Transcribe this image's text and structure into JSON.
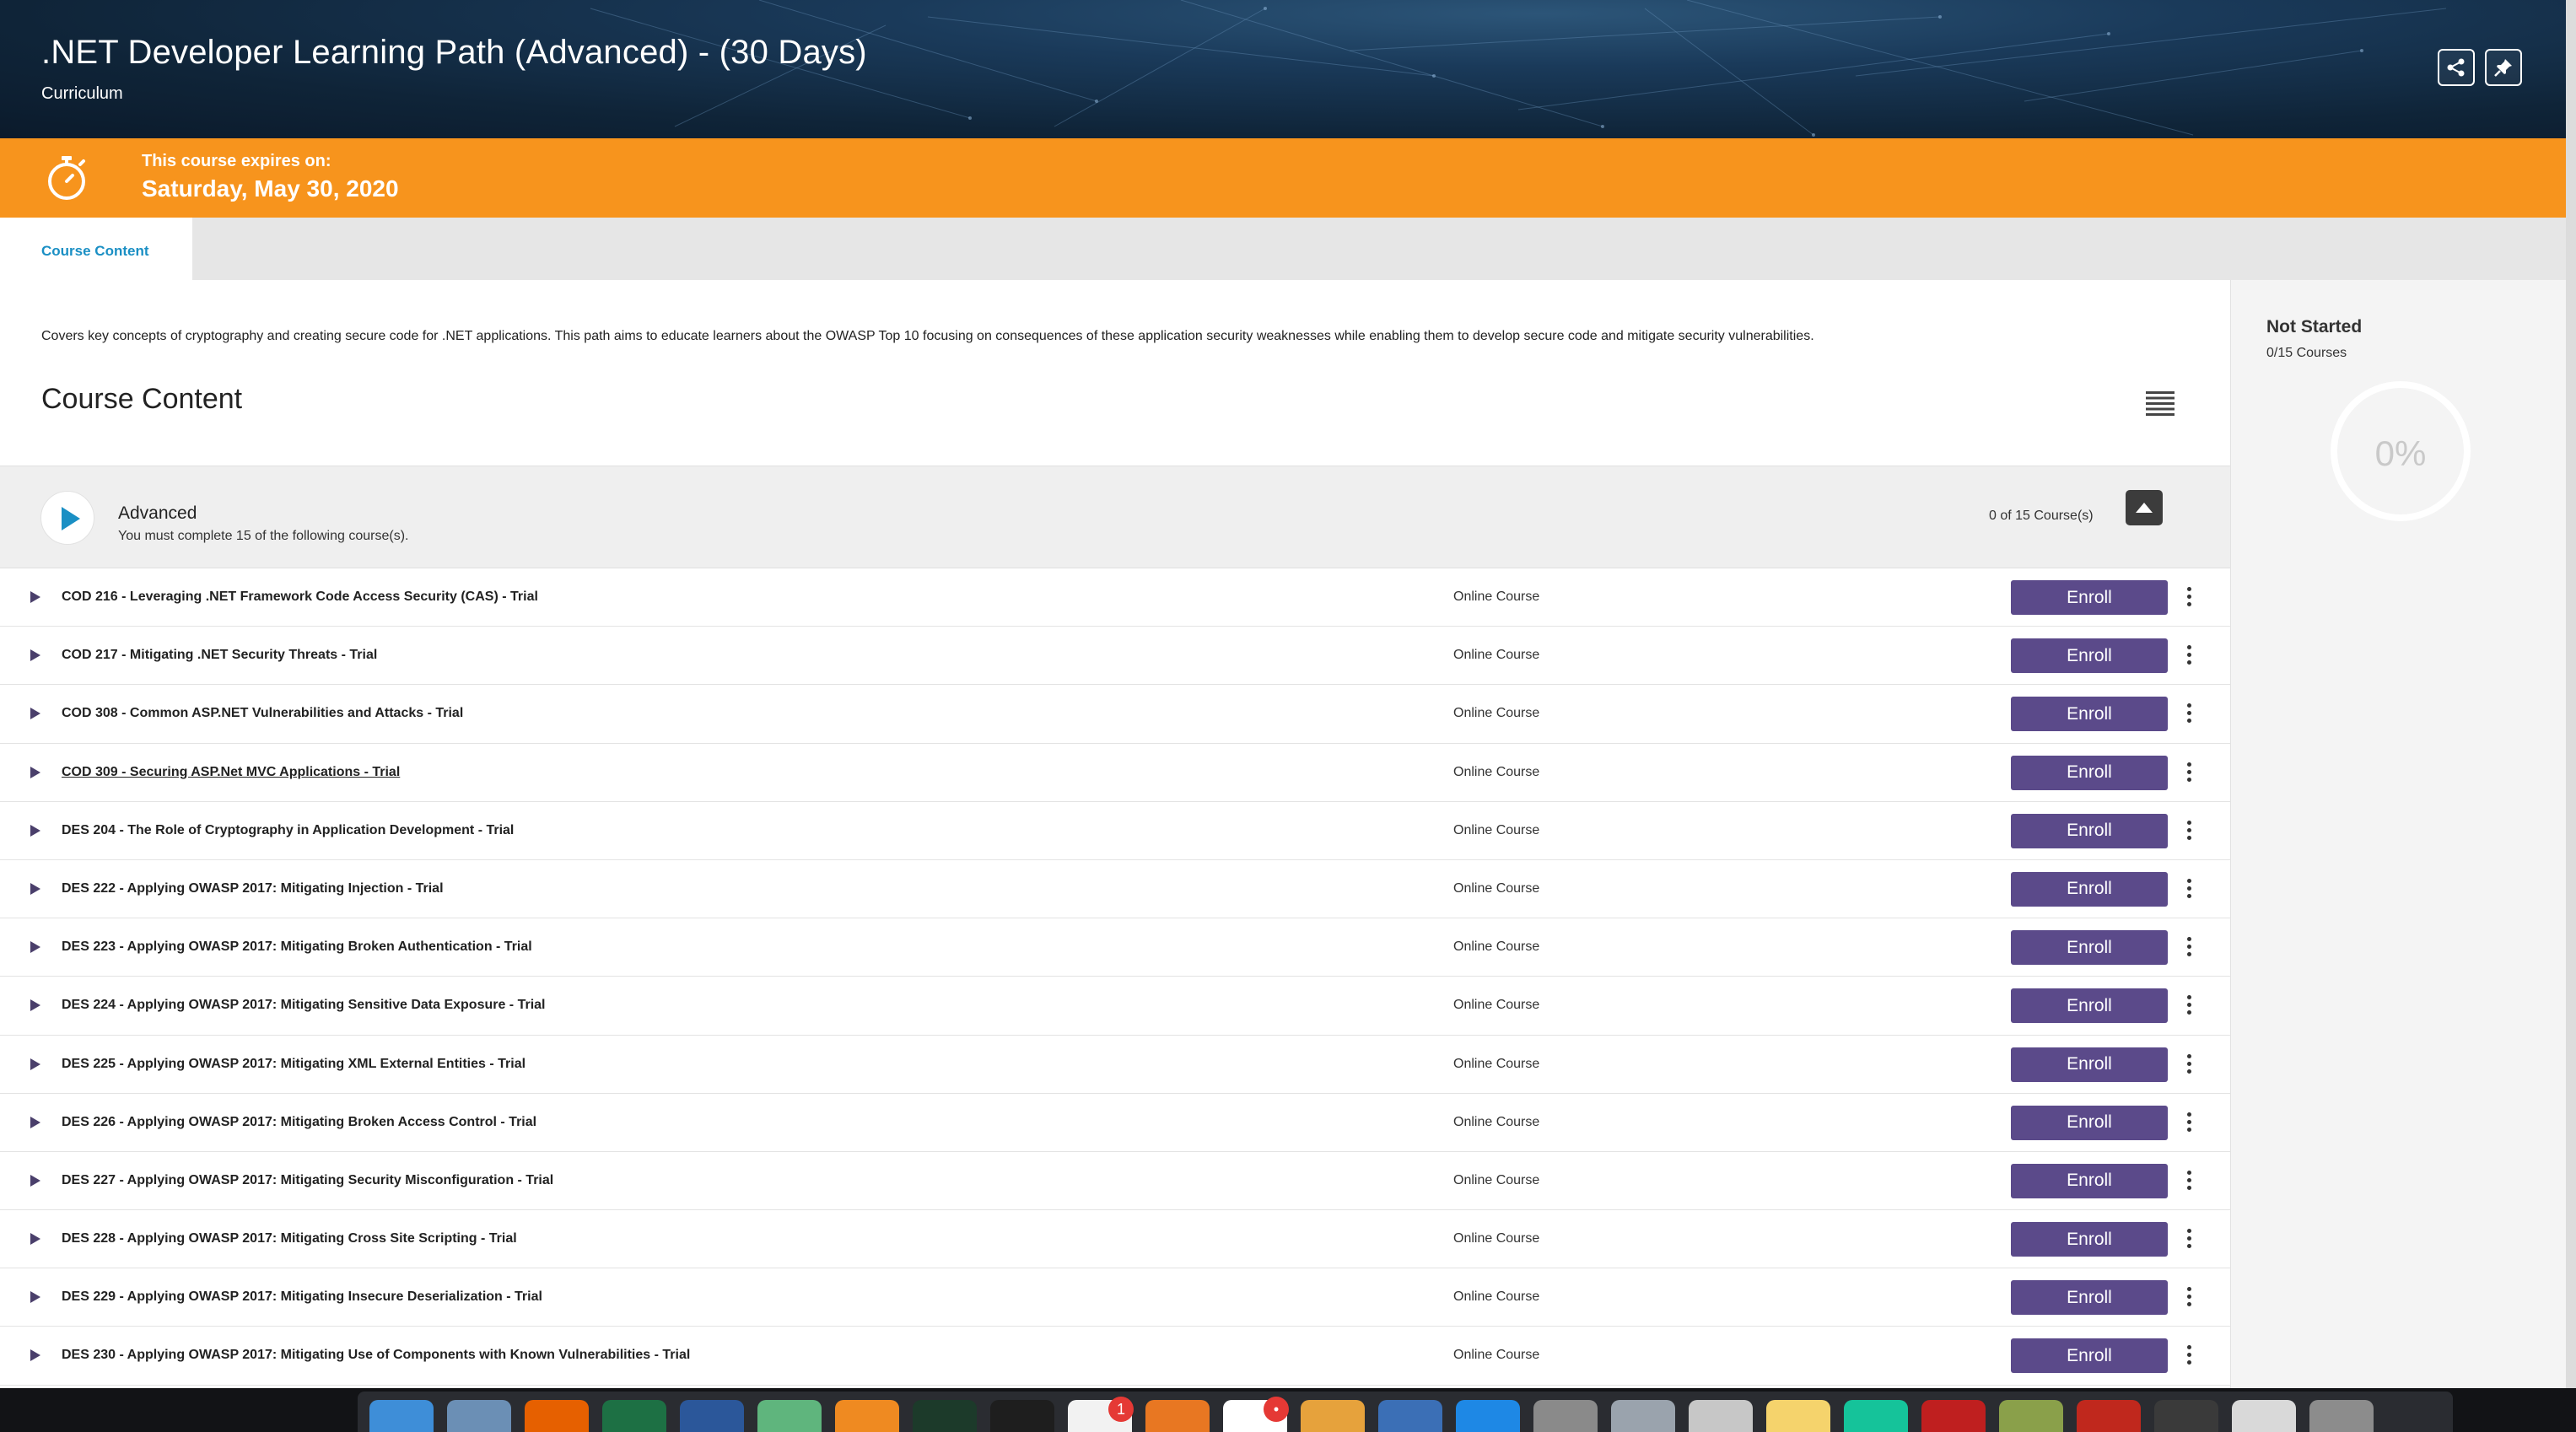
{
  "header": {
    "title": ".NET Developer Learning Path (Advanced) - (30 Days)",
    "subtitle": "Curriculum",
    "share_icon": "share-icon",
    "pin_icon": "pin-icon"
  },
  "expiry": {
    "label": "This course expires on:",
    "date": "Saturday, May 30, 2020",
    "icon": "stopwatch-icon",
    "color": "#f7941d"
  },
  "tabs": [
    {
      "label": "Course Content",
      "active": true
    }
  ],
  "main": {
    "description": "Covers key concepts of cryptography and creating secure code for .NET applications. This path aims to educate learners about the OWASP Top 10 focusing on consequences of these application security weaknesses while enabling them to develop secure code and mitigate security vulnerabilities.",
    "section_title": "Course Content",
    "view_icon": "list-view-icon"
  },
  "group": {
    "name": "Advanced",
    "requirement": "You must complete 15 of the following course(s).",
    "count": "0 of 15 Course(s)"
  },
  "courses": [
    {
      "title": "COD 216 - Leveraging .NET Framework Code Access Security (CAS) - Trial",
      "type": "Online Course",
      "action": "Enroll"
    },
    {
      "title": "COD 217 - Mitigating .NET Security Threats - Trial",
      "type": "Online Course",
      "action": "Enroll"
    },
    {
      "title": "COD 308 - Common ASP.NET Vulnerabilities and Attacks - Trial",
      "type": "Online Course",
      "action": "Enroll"
    },
    {
      "title": "COD 309 - Securing ASP.Net MVC Applications - Trial",
      "type": "Online Course",
      "action": "Enroll"
    },
    {
      "title": "DES 204 - The Role of Cryptography in Application Development - Trial",
      "type": "Online Course",
      "action": "Enroll"
    },
    {
      "title": "DES 222 - Applying OWASP 2017: Mitigating Injection - Trial",
      "type": "Online Course",
      "action": "Enroll"
    },
    {
      "title": "DES 223 - Applying OWASP 2017: Mitigating Broken Authentication - Trial",
      "type": "Online Course",
      "action": "Enroll"
    },
    {
      "title": "DES 224 - Applying OWASP 2017: Mitigating Sensitive Data Exposure - Trial",
      "type": "Online Course",
      "action": "Enroll"
    },
    {
      "title": "DES 225 - Applying OWASP 2017: Mitigating XML External Entities - Trial",
      "type": "Online Course",
      "action": "Enroll"
    },
    {
      "title": "DES 226 - Applying OWASP 2017: Mitigating Broken Access Control - Trial",
      "type": "Online Course",
      "action": "Enroll"
    },
    {
      "title": "DES 227 - Applying OWASP 2017: Mitigating Security Misconfiguration - Trial",
      "type": "Online Course",
      "action": "Enroll"
    },
    {
      "title": "DES 228 - Applying OWASP 2017: Mitigating Cross Site Scripting - Trial",
      "type": "Online Course",
      "action": "Enroll"
    },
    {
      "title": "DES 229 - Applying OWASP 2017: Mitigating Insecure Deserialization - Trial",
      "type": "Online Course",
      "action": "Enroll"
    },
    {
      "title": "DES 230 - Applying OWASP 2017: Mitigating Use of Components with Known Vulnerabilities - Trial",
      "type": "Online Course",
      "action": "Enroll"
    }
  ],
  "progress": {
    "status": "Not Started",
    "count": "0/15 Courses",
    "percent_label": "0%",
    "completed_fraction": 0
  },
  "dock": {
    "apps": [
      {
        "icon": "finder-icon",
        "color": "#3e8ed8"
      },
      {
        "icon": "preview-icon",
        "color": "#6b8fb5"
      },
      {
        "icon": "firefox-icon",
        "color": "#e66000"
      },
      {
        "icon": "excel-icon",
        "color": "#1d7044"
      },
      {
        "icon": "word-icon",
        "color": "#2b579a"
      },
      {
        "icon": "atom-icon",
        "color": "#5fb57d"
      },
      {
        "icon": "sublime-icon",
        "color": "#ef8a21"
      },
      {
        "icon": "charles-icon",
        "color": "#1c3a2a"
      },
      {
        "icon": "terminal-icon",
        "color": "#1e1e1e"
      },
      {
        "icon": "calendar-icon",
        "color": "#f2f2f2",
        "badge": "1"
      },
      {
        "icon": "zoom-icon",
        "color": "#e87722"
      },
      {
        "icon": "slack-icon",
        "color": "#ffffff",
        "badge": "•"
      },
      {
        "icon": "phone-icon",
        "color": "#e6a23c"
      },
      {
        "icon": "globe-icon",
        "color": "#3b6fb6"
      },
      {
        "icon": "app-store-icon",
        "color": "#1e88e5"
      },
      {
        "icon": "system-preferences-icon",
        "color": "#8a8a8a"
      },
      {
        "icon": "safari-icon",
        "color": "#9aa3ad"
      },
      {
        "icon": "calculator-icon",
        "color": "#c7c7c7"
      },
      {
        "icon": "notes-icon",
        "color": "#f5d36c"
      },
      {
        "icon": "grammarly-icon",
        "color": "#15c39a"
      },
      {
        "icon": "filezilla-icon",
        "color": "#bf1f1f"
      },
      {
        "icon": "cleanmymac-icon",
        "color": "#8aa04a"
      },
      {
        "icon": "acrobat-icon",
        "color": "#c0281d"
      },
      {
        "icon": "window-thumb-icon",
        "color": "#3a3a3a"
      },
      {
        "icon": "window-thumb-icon",
        "color": "#d9d9d9"
      },
      {
        "icon": "trash-icon",
        "color": "#8c8c8c"
      }
    ]
  }
}
